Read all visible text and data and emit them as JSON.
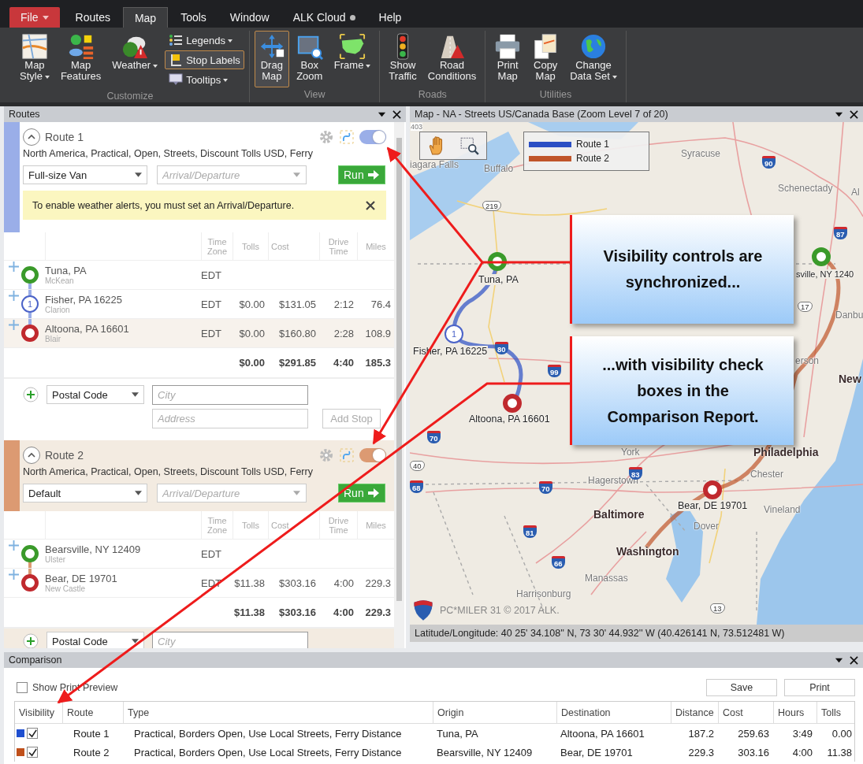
{
  "menu_tabs": [
    {
      "label": "File",
      "kind": "file",
      "selected": false,
      "dot": false
    },
    {
      "label": "Routes",
      "kind": "tab",
      "selected": false,
      "dot": false
    },
    {
      "label": "Map",
      "kind": "tab",
      "selected": true,
      "dot": false
    },
    {
      "label": "Tools",
      "kind": "tab",
      "selected": false,
      "dot": false
    },
    {
      "label": "Window",
      "kind": "tab",
      "selected": false,
      "dot": false
    },
    {
      "label": "ALK Cloud",
      "kind": "tab",
      "selected": false,
      "dot": true
    },
    {
      "label": "Help",
      "kind": "tab",
      "selected": false,
      "dot": false
    }
  ],
  "ribbon_groups": [
    {
      "label": "Customize",
      "items": [
        {
          "kind": "large",
          "label": "Map\nStyle",
          "dropdown": true,
          "selected": false
        },
        {
          "kind": "large",
          "label": "Map\nFeatures",
          "dropdown": false,
          "selected": false
        },
        {
          "kind": "large",
          "label": "Weather",
          "dropdown": true,
          "selected": false
        },
        {
          "kind": "small",
          "label": "Legends",
          "dropdown": true,
          "selected": false
        },
        {
          "kind": "small",
          "label": "Stop Labels",
          "dropdown": false,
          "selected": true
        },
        {
          "kind": "small",
          "label": "Tooltips",
          "dropdown": true,
          "selected": false
        }
      ]
    },
    {
      "label": "View",
      "items": [
        {
          "kind": "large",
          "label": "Drag\nMap",
          "dropdown": false,
          "selected": true
        },
        {
          "kind": "large",
          "label": "Box\nZoom",
          "dropdown": false,
          "selected": false
        },
        {
          "kind": "large",
          "label": "Frame",
          "dropdown": true,
          "selected": false
        }
      ]
    },
    {
      "label": "Roads",
      "items": [
        {
          "kind": "large",
          "label": "Show\nTraffic",
          "dropdown": false,
          "selected": false
        },
        {
          "kind": "large",
          "label": "Road\nConditions",
          "dropdown": false,
          "selected": false
        }
      ]
    },
    {
      "label": "Utilities",
      "items": [
        {
          "kind": "large",
          "label": "Print\nMap",
          "dropdown": false,
          "selected": false
        },
        {
          "kind": "large",
          "label": "Copy\nMap",
          "dropdown": false,
          "selected": false
        },
        {
          "kind": "large",
          "label": "Change\nData Set",
          "dropdown": true,
          "selected": false
        }
      ]
    }
  ],
  "routes_panel": {
    "title": "Routes",
    "routes": [
      {
        "name": "Route 1",
        "settings": "North America, Practical, Open, Streets, Discount Tolls USD, Ferry",
        "color": "#9aaee8",
        "shaded": false,
        "visible": true,
        "vehicle": "Full-size Van",
        "time_field": {
          "placeholder": "Arrival/Departure"
        },
        "run_label": "Run",
        "alert": "To enable weather alerts, you must set an Arrival/Departure.",
        "columns": [
          "Time Zone",
          "Tolls",
          "Cost",
          "Drive Time",
          "Miles"
        ],
        "stops": [
          {
            "kind": "origin",
            "name": "Tuna, PA",
            "county": "McKean",
            "time_zone": "EDT",
            "selected": false
          },
          {
            "kind": "via",
            "marker": "1",
            "name": "Fisher, PA 16225",
            "county": "Clarion",
            "time_zone": "EDT",
            "tolls": "$0.00",
            "cost": "$131.05",
            "drive_time": "2:12",
            "miles": "76.4",
            "selected": false
          },
          {
            "kind": "destination",
            "name": "Altoona, PA 16601",
            "county": "Blair",
            "time_zone": "EDT",
            "tolls": "$0.00",
            "cost": "$160.80",
            "drive_time": "2:28",
            "miles": "108.9",
            "selected": true
          }
        ],
        "totals": {
          "tolls": "$0.00",
          "cost": "$291.85",
          "drive_time": "4:40",
          "miles": "185.3"
        },
        "add_stop": {
          "type": "Postal Code",
          "city": {
            "placeholder": "City"
          },
          "address": {
            "placeholder": "Address"
          },
          "button": "Add Stop"
        }
      },
      {
        "name": "Route 2",
        "settings": "North America, Practical, Open, Streets, Discount Tolls USD, Ferry",
        "color": "#dc9a72",
        "shaded": true,
        "visible": true,
        "vehicle": "Default",
        "time_field": {
          "placeholder": "Arrival/Departure"
        },
        "run_label": "Run",
        "columns": [
          "Time Zone",
          "Tolls",
          "Cost",
          "Drive Time",
          "Miles"
        ],
        "stops": [
          {
            "kind": "origin",
            "name": "Bearsville, NY 12409",
            "county": "Ulster",
            "time_zone": "EDT",
            "selected": false
          },
          {
            "kind": "destination",
            "name": "Bear, DE 19701",
            "county": "New Castle",
            "time_zone": "EDT",
            "tolls": "$11.38",
            "cost": "$303.16",
            "drive_time": "4:00",
            "miles": "229.3",
            "selected": false
          }
        ],
        "totals": {
          "tolls": "$11.38",
          "cost": "$303.16",
          "drive_time": "4:00",
          "miles": "229.3"
        },
        "add_stop": {
          "type": "Postal Code",
          "city": {
            "placeholder": "City"
          }
        }
      }
    ]
  },
  "map_panel": {
    "title": "Map - NA - Streets US/Canada Base (Zoom Level 7 of 20)",
    "legend": [
      {
        "label": "Route 1",
        "color": "#2b4fc4"
      },
      {
        "label": "Route 2",
        "color": "#c0552a"
      }
    ],
    "labels": [
      {
        "text": "403",
        "kind": "small"
      },
      {
        "text": "iagara Falls",
        "kind": "city"
      },
      {
        "text": "Buffalo",
        "kind": "city"
      },
      {
        "text": "Syracuse",
        "kind": "city"
      },
      {
        "text": "Schenectady",
        "kind": "city"
      },
      {
        "text": "Al",
        "kind": "city"
      },
      {
        "text": "Tuna, PA",
        "kind": "stop"
      },
      {
        "text": "Fisher, PA 16225",
        "kind": "stop"
      },
      {
        "text": "Altoona, PA 16601",
        "kind": "stop"
      },
      {
        "text": "sville, NY 1240",
        "kind": "stop"
      },
      {
        "text": "Danbu",
        "kind": "city"
      },
      {
        "text": "erson",
        "kind": "city"
      },
      {
        "text": "New",
        "kind": "major"
      },
      {
        "text": "York",
        "kind": "city"
      },
      {
        "text": "Philadelphia",
        "kind": "major"
      },
      {
        "text": "Chester",
        "kind": "city"
      },
      {
        "text": "Hagerstown",
        "kind": "city"
      },
      {
        "text": "Baltimore",
        "kind": "major"
      },
      {
        "text": "Bear, DE 19701",
        "kind": "stop"
      },
      {
        "text": "Vineland",
        "kind": "city"
      },
      {
        "text": "Dover",
        "kind": "city"
      },
      {
        "text": "Washington",
        "kind": "major"
      },
      {
        "text": "Manassas",
        "kind": "city"
      },
      {
        "text": "Harrisonburg",
        "kind": "city"
      },
      {
        "text": "90",
        "kind": "interstate"
      },
      {
        "text": "87",
        "kind": "interstate"
      },
      {
        "text": "80",
        "kind": "interstate"
      },
      {
        "text": "99",
        "kind": "interstate"
      },
      {
        "text": "70",
        "kind": "interstate"
      },
      {
        "text": "68",
        "kind": "interstate"
      },
      {
        "text": "70",
        "kind": "interstate"
      },
      {
        "text": "83",
        "kind": "interstate"
      },
      {
        "text": "81",
        "kind": "interstate"
      },
      {
        "text": "66",
        "kind": "interstate"
      },
      {
        "text": "219",
        "kind": "us"
      },
      {
        "text": "40",
        "kind": "us"
      },
      {
        "text": "13",
        "kind": "us"
      },
      {
        "text": "17",
        "kind": "us"
      }
    ],
    "markers": [
      {
        "kind": "origin"
      },
      {
        "kind": "via",
        "number": "1"
      },
      {
        "kind": "destination"
      },
      {
        "kind": "origin"
      },
      {
        "kind": "destination"
      }
    ],
    "logo_text": "PC*MILER 31  © 2017 ALK.",
    "status": "Latitude/Longitude: 40 25' 34.108'' N,  73 30' 44.932'' W (40.426141 N, 73.512481 W)"
  },
  "callouts": [
    "Visibility controls are synchronized...",
    "...with visibility check boxes in the Comparison Report."
  ],
  "comparison": {
    "title": "Comparison",
    "print_preview": {
      "label": "Show Print Preview",
      "checked": false
    },
    "buttons": [
      "Save",
      "Print"
    ],
    "columns": [
      "Visibility",
      "Route",
      "Type",
      "Origin",
      "Destination",
      "Distance",
      "Cost",
      "Hours",
      "Tolls"
    ],
    "rows": [
      {
        "color": "#1f4fd0",
        "visible": true,
        "cells": [
          "",
          "Route 1",
          "Practical, Borders Open, Use Local Streets, Ferry Distance",
          "Tuna, PA",
          "Altoona, PA 16601",
          "187.2",
          "259.63",
          "3:49",
          "0.00"
        ]
      },
      {
        "color": "#c0501a",
        "visible": true,
        "cells": [
          "",
          "Route 2",
          "Practical, Borders Open, Use Local Streets, Ferry Distance",
          "Bearsville, NY 12409",
          "Bear, DE 19701",
          "229.3",
          "303.16",
          "4:00",
          "11.38"
        ]
      }
    ]
  }
}
